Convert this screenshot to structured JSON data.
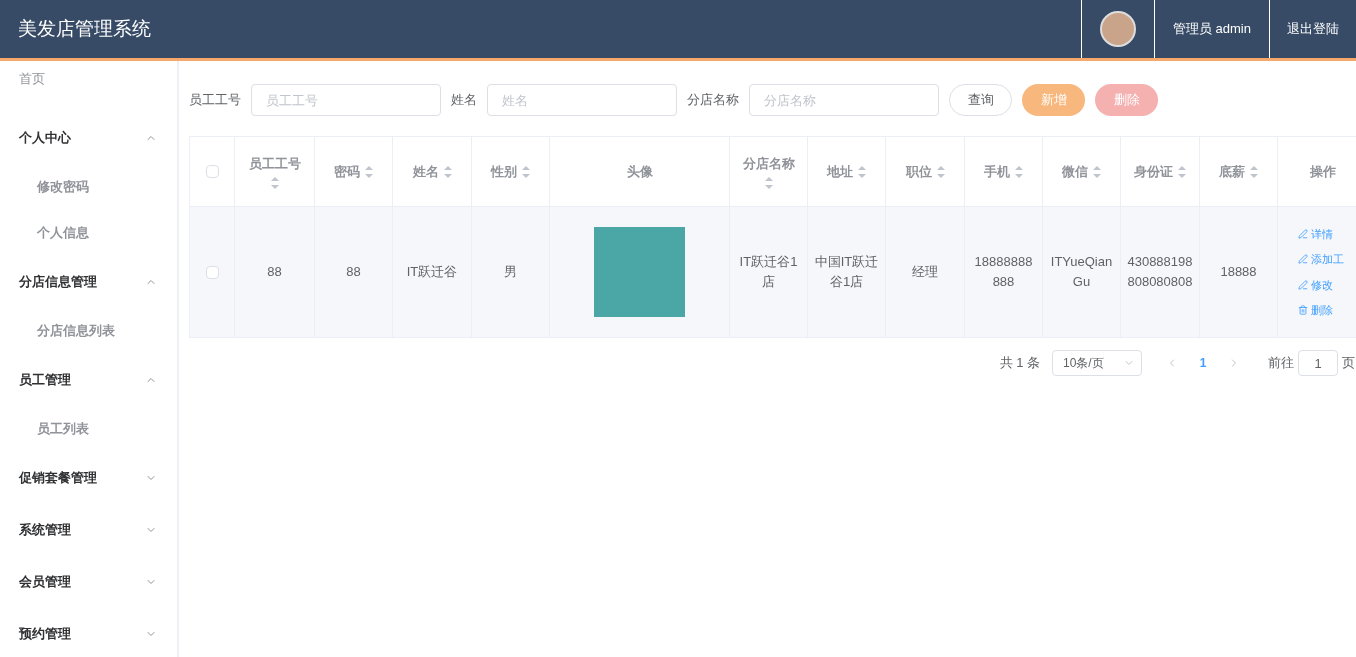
{
  "header": {
    "title": "美发店管理系统",
    "user": "管理员 admin",
    "logout": "退出登陆"
  },
  "sidebar": {
    "home": "首页",
    "groups": [
      {
        "label": "个人中心",
        "expanded": true,
        "children": [
          {
            "label": "修改密码"
          },
          {
            "label": "个人信息"
          }
        ]
      },
      {
        "label": "分店信息管理",
        "expanded": true,
        "children": [
          {
            "label": "分店信息列表"
          }
        ]
      },
      {
        "label": "员工管理",
        "expanded": true,
        "children": [
          {
            "label": "员工列表"
          }
        ]
      },
      {
        "label": "促销套餐管理",
        "expanded": false
      },
      {
        "label": "系统管理",
        "expanded": false
      },
      {
        "label": "会员管理",
        "expanded": false
      },
      {
        "label": "预约管理",
        "expanded": false
      }
    ]
  },
  "search": {
    "fields": [
      {
        "label": "员工工号",
        "placeholder": "员工工号"
      },
      {
        "label": "姓名",
        "placeholder": "姓名"
      },
      {
        "label": "分店名称",
        "placeholder": "分店名称"
      }
    ],
    "buttons": [
      {
        "label": "查询",
        "kind": "default"
      },
      {
        "label": "新增",
        "kind": "warning"
      },
      {
        "label": "删除",
        "kind": "danger",
        "disabled": true
      }
    ]
  },
  "table": {
    "select_all_checked": false,
    "columns": [
      {
        "label": "员工工号",
        "sortable": true
      },
      {
        "label": "密码",
        "sortable": true
      },
      {
        "label": "姓名",
        "sortable": true
      },
      {
        "label": "性别",
        "sortable": true
      },
      {
        "label": "头像",
        "sortable": false
      },
      {
        "label": "分店名称",
        "sortable": true
      },
      {
        "label": "地址",
        "sortable": true
      },
      {
        "label": "职位",
        "sortable": true
      },
      {
        "label": "手机",
        "sortable": true
      },
      {
        "label": "微信",
        "sortable": true
      },
      {
        "label": "身份证",
        "sortable": true
      },
      {
        "label": "底薪",
        "sortable": true
      },
      {
        "label": "操作",
        "sortable": false
      }
    ],
    "rows": [
      {
        "checked": false,
        "cells": [
          "88",
          "88",
          "IT跃迁谷",
          "男",
          null,
          "IT跃迁谷1店",
          "中国IT跃迁谷1店",
          "经理",
          "18888888888",
          "ITYueQianGu",
          "430888198808080808",
          "18888"
        ],
        "actions": [
          {
            "label": "详情",
            "kind": "edit"
          },
          {
            "label": "添加工",
            "kind": "edit"
          },
          {
            "label": "修改",
            "kind": "edit"
          },
          {
            "label": "删除",
            "kind": "delete"
          }
        ]
      }
    ]
  },
  "pagination": {
    "total": "共 1 条",
    "page_size": "10条/页",
    "pages": [
      {
        "label": "1",
        "selected": true
      }
    ],
    "goto_label": "前往",
    "goto_value": "1",
    "goto_suffix": "页"
  }
}
